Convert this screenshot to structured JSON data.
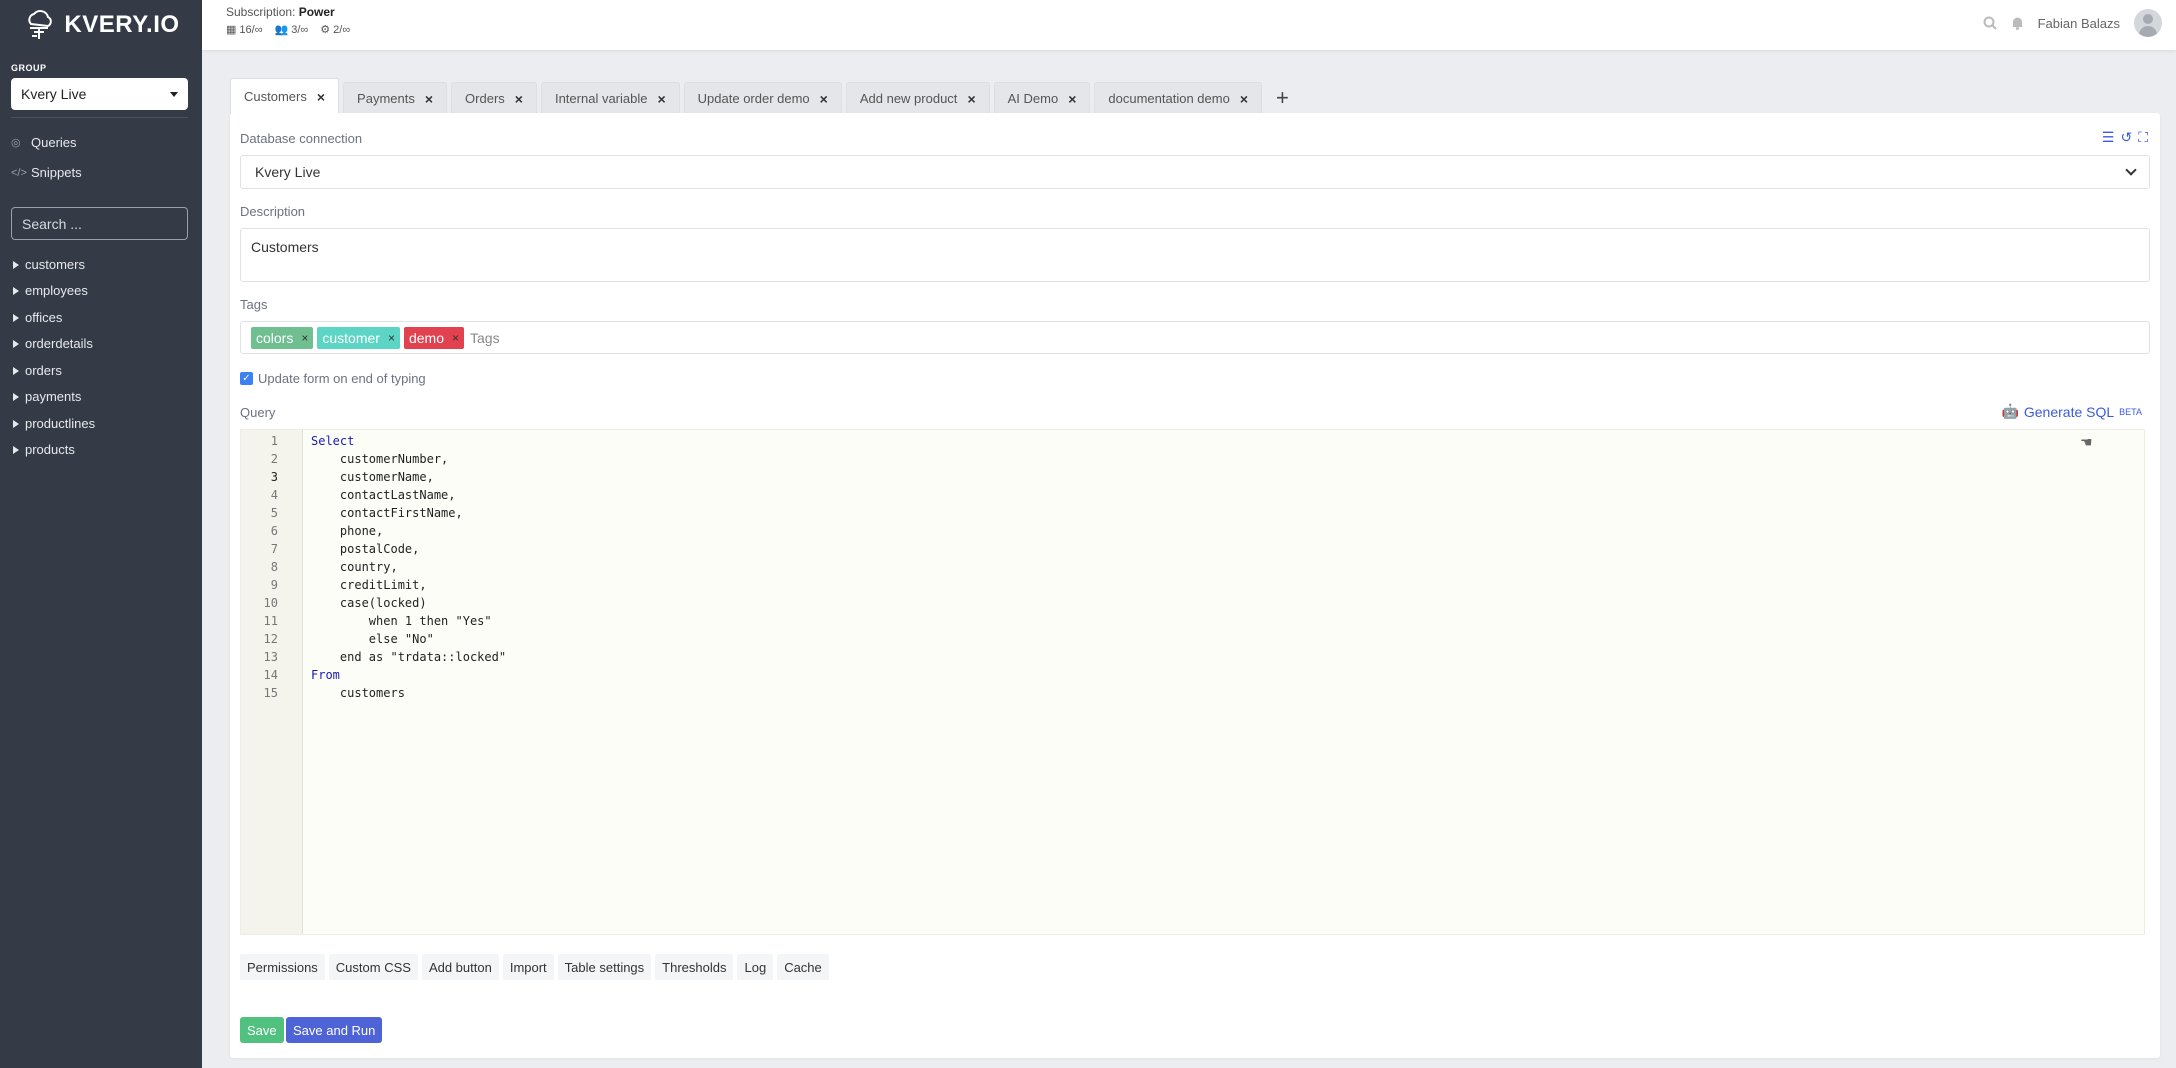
{
  "app": {
    "logo_text": "KVERY.IO"
  },
  "sidebar": {
    "group_label": "GROUP",
    "group_value": "Kvery Live",
    "nav": [
      {
        "label": "Queries",
        "icon": "gauge-icon"
      },
      {
        "label": "Snippets",
        "icon": "code-icon"
      }
    ],
    "search_placeholder": "Search ...",
    "tables": [
      "customers",
      "employees",
      "offices",
      "orderdetails",
      "orders",
      "payments",
      "productlines",
      "products"
    ]
  },
  "header": {
    "subscription_label": "Subscription:",
    "subscription_plan": "Power",
    "stats": [
      "16/∞",
      "3/∞",
      "2/∞"
    ],
    "user_name": "Fabian Balazs"
  },
  "tabs": [
    "Customers",
    "Payments",
    "Orders",
    "Internal variable",
    "Update order demo",
    "Add new product",
    "AI Demo",
    "documentation demo"
  ],
  "form": {
    "db_label": "Database connection",
    "db_value": "Kvery Live",
    "desc_label": "Description",
    "desc_value": "Customers",
    "tags_label": "Tags",
    "tags": [
      {
        "name": "colors",
        "color": "#6fbf91"
      },
      {
        "name": "customer",
        "color": "#5cd5c4"
      },
      {
        "name": "demo",
        "color": "#e2414f"
      }
    ],
    "tags_placeholder": "Tags",
    "checkbox_label": "Update form on end of typing",
    "query_label": "Query",
    "generate_sql": "Generate SQL",
    "beta": "BETA"
  },
  "query_lines": [
    "Select",
    "    customerNumber,",
    "    customerName,",
    "    contactLastName,",
    "    contactFirstName,",
    "    phone,",
    "    postalCode,",
    "    country,",
    "    creditLimit,",
    "    case(locked)",
    "        when 1 then \"Yes\"",
    "        else \"No\"",
    "    end as \"trdata::locked\"",
    "From",
    "    customers"
  ],
  "options": [
    "Permissions",
    "Custom CSS",
    "Add button",
    "Import",
    "Table settings",
    "Thresholds",
    "Log",
    "Cache"
  ],
  "buttons": {
    "save": "Save",
    "save_and_run": "Save and Run"
  },
  "colors": {
    "sidebar_bg": "#343a46",
    "accent": "#3b5bdb",
    "save_green": "#51c17f",
    "run_blue": "#4e63d6"
  }
}
